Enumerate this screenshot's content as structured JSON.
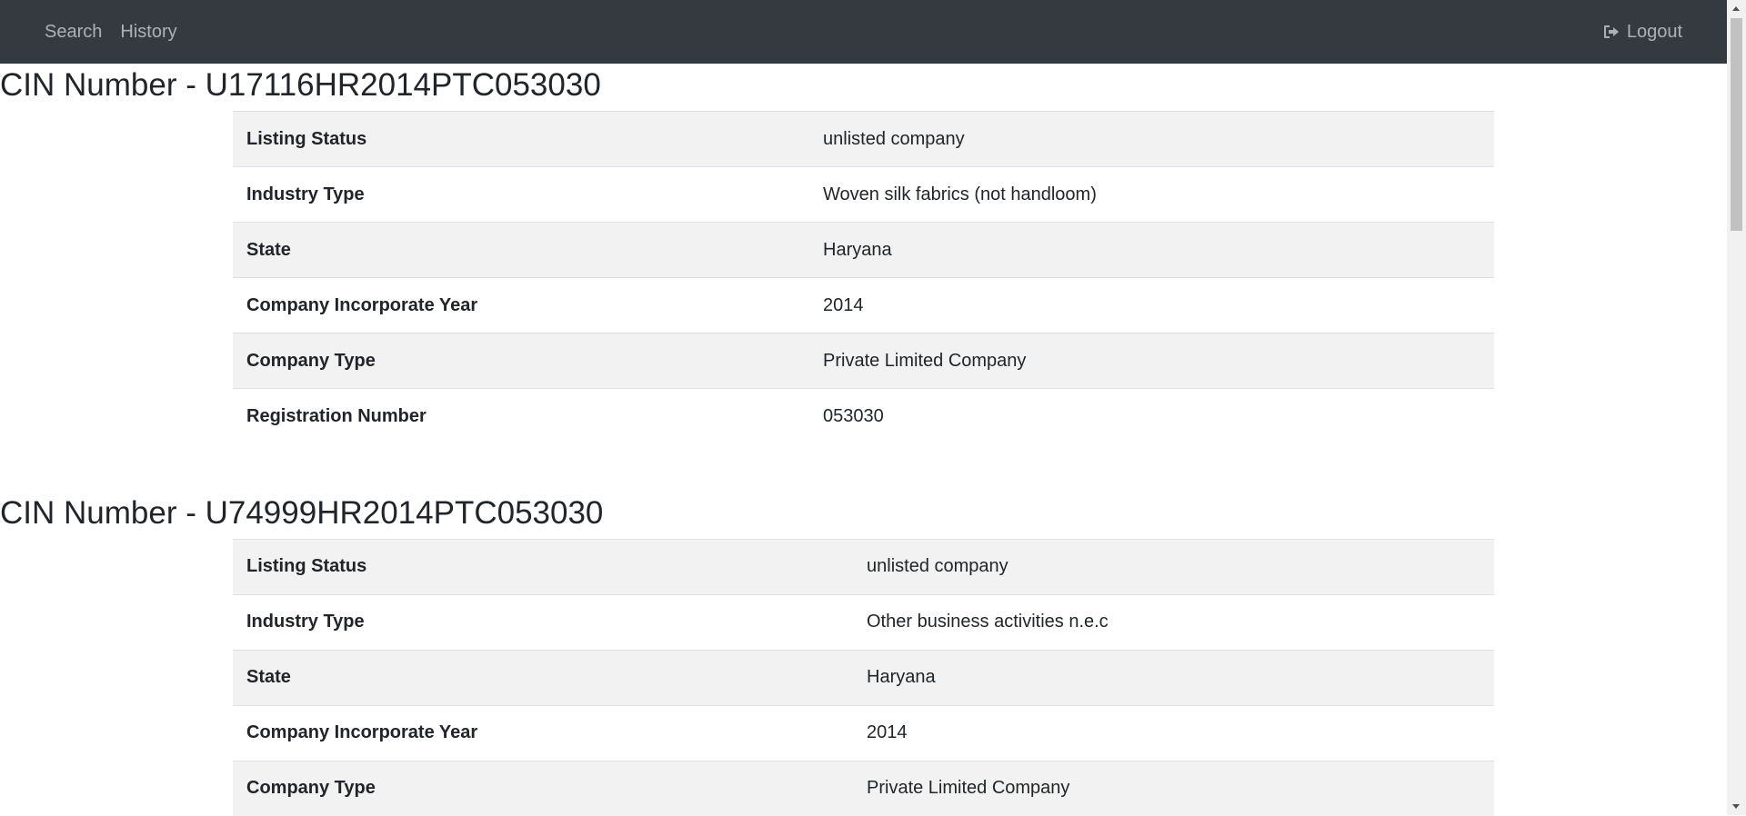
{
  "nav": {
    "search_label": "Search",
    "history_label": "History",
    "logout_label": "Logout",
    "logout_icon": "sign-out-icon"
  },
  "sections": [
    {
      "title": "CIN Number - U17116HR2014PTC053030",
      "rows": [
        {
          "label": "Listing Status",
          "value": "unlisted company"
        },
        {
          "label": "Industry Type",
          "value": "Woven silk fabrics (not handloom)"
        },
        {
          "label": "State",
          "value": "Haryana"
        },
        {
          "label": "Company Incorporate Year",
          "value": "2014"
        },
        {
          "label": "Company Type",
          "value": "Private Limited Company"
        },
        {
          "label": "Registration Number",
          "value": "053030"
        }
      ]
    },
    {
      "title": "CIN Number - U74999HR2014PTC053030",
      "rows": [
        {
          "label": "Listing Status",
          "value": "unlisted company"
        },
        {
          "label": "Industry Type",
          "value": "Other business activities n.e.c"
        },
        {
          "label": "State",
          "value": "Haryana"
        },
        {
          "label": "Company Incorporate Year",
          "value": "2014"
        },
        {
          "label": "Company Type",
          "value": "Private Limited Company"
        }
      ]
    }
  ],
  "colors": {
    "navbar_bg": "#343a40",
    "stripe": "#f2f2f2",
    "text": "#212529"
  }
}
